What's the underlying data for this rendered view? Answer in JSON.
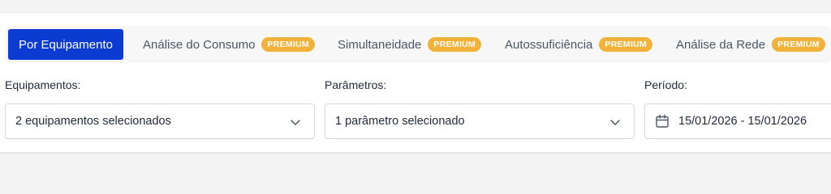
{
  "tabs": {
    "items": [
      {
        "label": "Por Equipamento",
        "badge": ""
      },
      {
        "label": "Análise do Consumo",
        "badge": "PREMIUM"
      },
      {
        "label": "Simultaneidade",
        "badge": "PREMIUM"
      },
      {
        "label": "Autossuficiência",
        "badge": "PREMIUM"
      },
      {
        "label": "Análise da Rede",
        "badge": "PREMIUM"
      }
    ],
    "active_index": 0
  },
  "filters": {
    "equipment": {
      "label": "Equipamentos:",
      "value": "2 equipamentos selecionados",
      "icon": "chevron-down-icon"
    },
    "parameters": {
      "label": "Parâmetros:",
      "value": "1 parâmetro selecionado",
      "icon": "chevron-down-icon"
    },
    "period": {
      "label": "Período:",
      "value": "15/01/2026 - 15/01/2026",
      "icon": "calendar-icon"
    }
  },
  "colors": {
    "accent": "#0b3bd1",
    "premium_badge": "#f2b23a",
    "page_background": "#f4f4f4"
  }
}
